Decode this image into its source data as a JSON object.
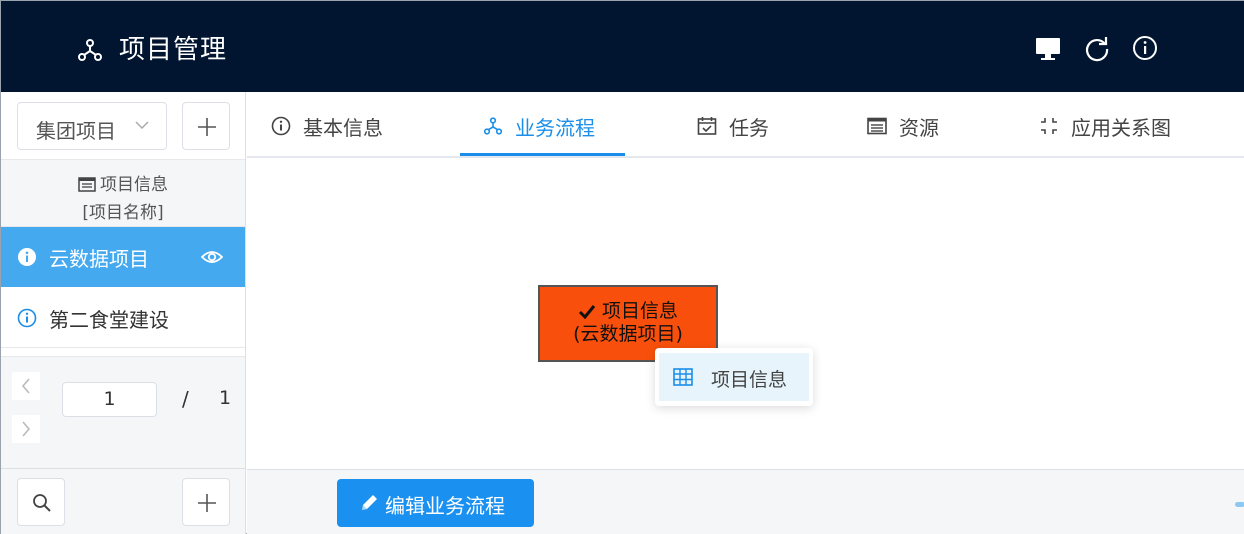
{
  "header": {
    "app_icon": "network-nodes-icon",
    "title": "项目管理",
    "actions": [
      {
        "icon": "monitor-icon"
      },
      {
        "icon": "refresh-icon"
      },
      {
        "icon": "info-icon"
      }
    ]
  },
  "sidebar": {
    "group_select": {
      "value": "集团项目"
    },
    "add_icon": "plus-icon",
    "project_header": {
      "icon": "list-card-icon",
      "title": "项目信息",
      "subtitle": "[项目名称]"
    },
    "items": [
      {
        "label": "云数据项目",
        "active": true,
        "icon": "info-icon",
        "trailing_icon": "eye-icon"
      },
      {
        "label": "第二食堂建设",
        "active": false,
        "icon": "info-icon"
      }
    ],
    "pager": {
      "prev_icon": "chevron-left-icon",
      "next_icon": "chevron-right-icon",
      "current_page": "1",
      "separator": "/",
      "total_pages": "1"
    },
    "footer": {
      "search_icon": "search-icon",
      "add_icon": "plus-icon"
    }
  },
  "tabs": [
    {
      "label": "基本信息",
      "icon": "info-icon",
      "active": false
    },
    {
      "label": "业务流程",
      "icon": "network-nodes-icon",
      "active": true
    },
    {
      "label": "任务",
      "icon": "calendar-check-icon",
      "active": false
    },
    {
      "label": "资源",
      "icon": "list-card-icon",
      "active": false
    },
    {
      "label": "应用关系图",
      "icon": "shrink-icon",
      "active": false
    }
  ],
  "canvas": {
    "node": {
      "icon": "check-icon",
      "title": "项目信息",
      "subtitle": "(云数据项目)",
      "color": "#f8500c"
    },
    "context_menu": {
      "items": [
        {
          "label": "项目信息",
          "icon": "table-icon"
        }
      ]
    }
  },
  "bottom_bar": {
    "edit_button": {
      "label": "编辑业务流程",
      "icon": "pencil-icon",
      "color": "#1a90f0"
    }
  },
  "colors": {
    "header_bg": "#021530",
    "accent": "#1a8ee8",
    "sidebar_active": "#45a9ef"
  }
}
